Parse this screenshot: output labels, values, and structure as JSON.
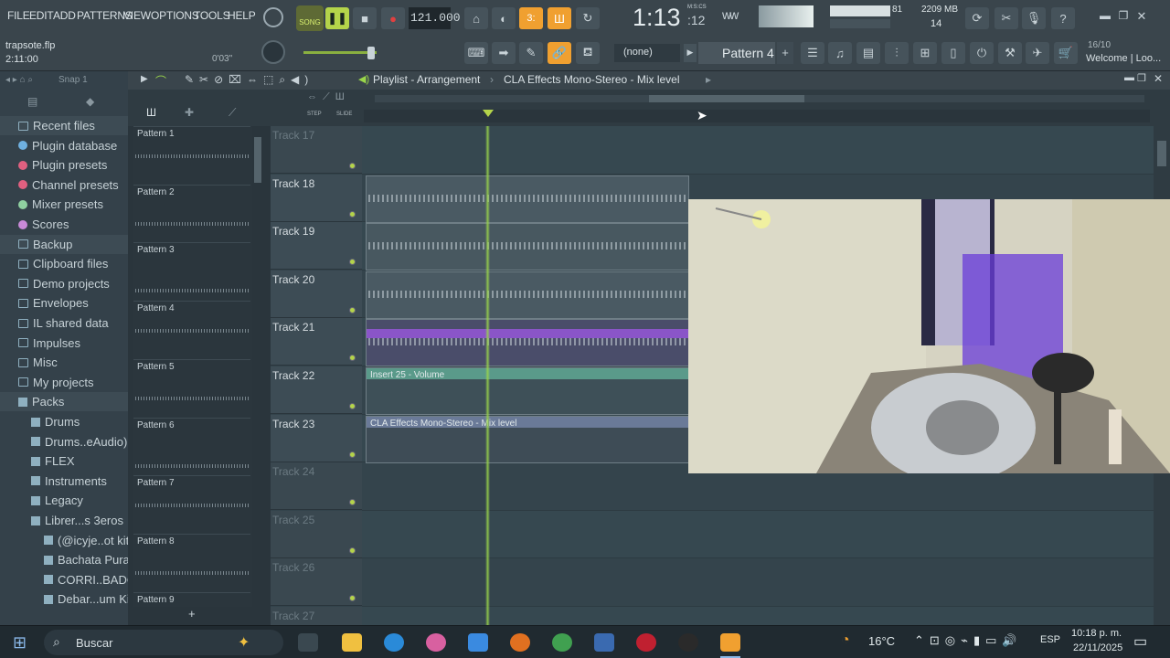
{
  "menu": [
    "FILE",
    "EDIT",
    "ADD",
    "PATTERNS",
    "VIEW",
    "OPTIONS",
    "TOOLS",
    "HELP"
  ],
  "song_mode": "SONG",
  "tempo": "121.000",
  "time_display": "1:13",
  "time_mode": "M:S:CS",
  "time_fraction": ":12",
  "cpu_value": "81",
  "memory": "2209 MB",
  "voices": "14",
  "project_file": "trapsote.flp",
  "project_position": "2:11:00",
  "hint_time": "0'03\"",
  "snap_label": "(none)",
  "pattern_selector": "Pattern 4",
  "hint_date": "16/10",
  "hint_text": "Welcome | Loo...",
  "browser_snap": "Snap 1",
  "playlist_title": "Playlist - Arrangement",
  "playlist_breadcrumb": "CLA Effects Mono-Stereo - Mix level",
  "step_label": "STEP",
  "slide_label": "SLIDE",
  "browser": {
    "items": [
      {
        "label": "Recent files",
        "kind": "special"
      },
      {
        "label": "Plugin database",
        "kind": "plugin",
        "color": "#6fb0e0"
      },
      {
        "label": "Plugin presets",
        "kind": "plugin",
        "color": "#e06080"
      },
      {
        "label": "Channel presets",
        "kind": "plugin",
        "color": "#e06080"
      },
      {
        "label": "Mixer presets",
        "kind": "plugin",
        "color": "#8fd0a0"
      },
      {
        "label": "Scores",
        "kind": "plugin",
        "color": "#c88ad8"
      },
      {
        "label": "Backup",
        "kind": "special"
      },
      {
        "label": "Clipboard files",
        "kind": "folder"
      },
      {
        "label": "Demo projects",
        "kind": "folder"
      },
      {
        "label": "Envelopes",
        "kind": "folder"
      },
      {
        "label": "IL shared data",
        "kind": "folder"
      },
      {
        "label": "Impulses",
        "kind": "folder"
      },
      {
        "label": "Misc",
        "kind": "folder"
      },
      {
        "label": "My projects",
        "kind": "folder"
      },
      {
        "label": "Packs",
        "kind": "packs"
      },
      {
        "label": "Drums",
        "kind": "pack",
        "indent": 1
      },
      {
        "label": "Drums..eAudio)",
        "kind": "pack",
        "indent": 1
      },
      {
        "label": "FLEX",
        "kind": "pack",
        "indent": 1
      },
      {
        "label": "Instruments",
        "kind": "pack",
        "indent": 1
      },
      {
        "label": "Legacy",
        "kind": "pack",
        "indent": 1
      },
      {
        "label": "Librer...s 3eros",
        "kind": "pack",
        "indent": 1
      },
      {
        "label": "(@icyje..ot kit",
        "kind": "pack",
        "indent": 2
      },
      {
        "label": "Bachata Pura",
        "kind": "pack",
        "indent": 2
      },
      {
        "label": "CORRI..BADOS",
        "kind": "pack",
        "indent": 2
      },
      {
        "label": "Debar...um Kit",
        "kind": "pack",
        "indent": 2
      }
    ]
  },
  "patterns": [
    "Pattern 1",
    "Pattern 2",
    "Pattern 3",
    "Pattern 4",
    "Pattern 5",
    "Pattern 6",
    "Pattern 7",
    "Pattern 8",
    "Pattern 9"
  ],
  "tracks": [
    "Track 17",
    "Track 18",
    "Track 19",
    "Track 20",
    "Track 21",
    "Track 22",
    "Track 23",
    "Track 24",
    "Track 25",
    "Track 26",
    "Track 27"
  ],
  "clips": {
    "insert": "Insert 25 - Volume",
    "cla": "CLA Effects Mono-Stereo - Mix level"
  },
  "taskbar": {
    "search": "Buscar",
    "weather": "16°C",
    "lang": "ESP",
    "time": "10:18 p. m.",
    "date": "22/11/2025"
  },
  "colors": {
    "accent": "#f0a030",
    "playhead": "#9ad64a",
    "purple_clip": "#8a55c8",
    "teal_clip": "#5a9a8a"
  }
}
